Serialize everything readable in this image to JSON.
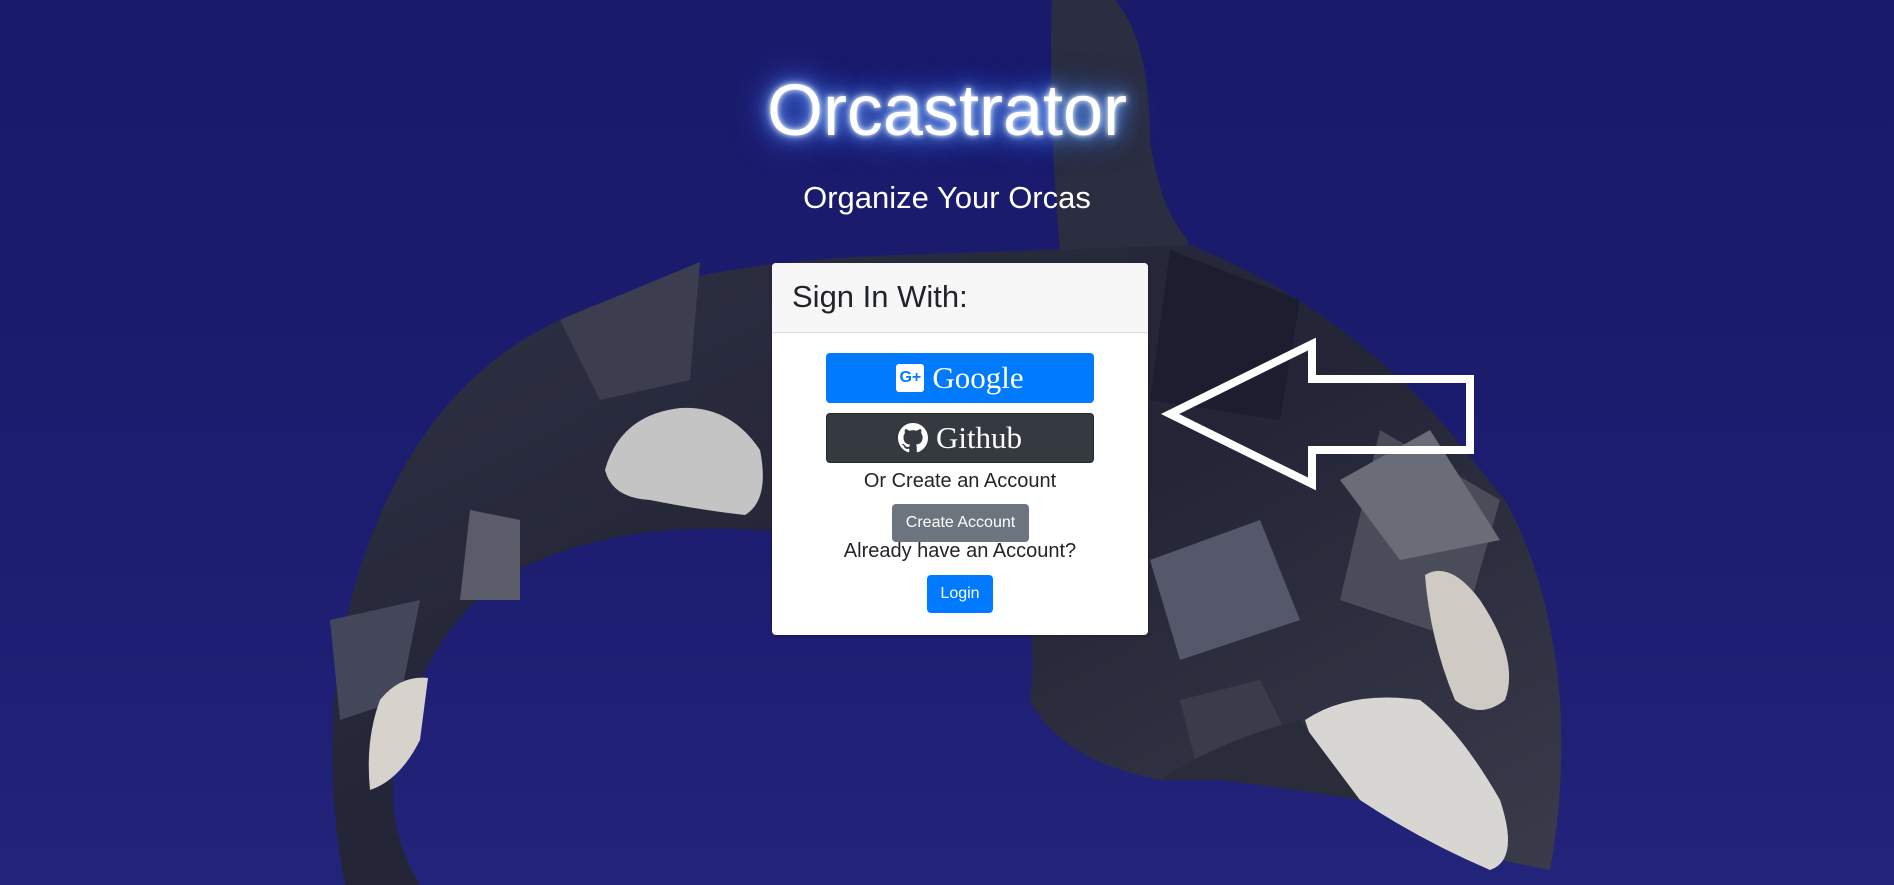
{
  "app": {
    "title": "Orcastrator",
    "subtitle": "Organize Your Orcas"
  },
  "signin_card": {
    "header": "Sign In With:",
    "google_label": "Google",
    "github_label": "Github",
    "create_prompt": "Or Create an Account",
    "create_button": "Create Account",
    "login_prompt": "Already have an Account?",
    "login_button": "Login"
  },
  "icons": {
    "google": "google-plus-icon",
    "github": "github-icon",
    "arrow": "left-arrow-icon"
  },
  "colors": {
    "background": "#1a1a6b",
    "primary": "#007bff",
    "dark": "#343a40",
    "secondary": "#6c757d",
    "title_glow": "#4f8cff"
  }
}
